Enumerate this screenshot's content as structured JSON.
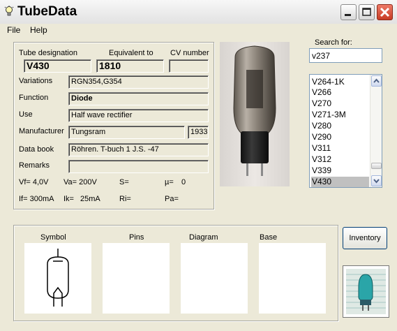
{
  "window": {
    "title": "TubeData",
    "app_icon": "lightbulb-icon"
  },
  "menu": {
    "file": "File",
    "help": "Help"
  },
  "fields": {
    "tube_designation_label": "Tube designation",
    "tube_designation": "V430",
    "equivalent_label": "Equivalent to",
    "equivalent": "1810",
    "cv_label": "CV number",
    "cv": "",
    "variations_label": "Variations",
    "variations": "RGN354,G354",
    "function_label": "Function",
    "function": "Diode",
    "use_label": "Use",
    "use": "Half wave rectifier",
    "manufacturer_label": "Manufacturer",
    "manufacturer": "Tungsram",
    "year": "1933",
    "databook_label": "Data book",
    "databook": "Röhren. T-buch 1 J.S. -47",
    "remarks_label": "Remarks",
    "remarks": ""
  },
  "params": {
    "vf": "Vf= 4,0V",
    "va": "Va= 200V",
    "s": "S=",
    "mu": "µ=",
    "mu_value": "0",
    "if": "If= 300mA",
    "ik": "Ik=",
    "ik_value": "25mA",
    "ri": "Ri=",
    "pa": "Pa="
  },
  "search": {
    "label": "Search for:",
    "value": "v237"
  },
  "list": {
    "items": [
      "V264-1K",
      "V266",
      "V270",
      "V271-3M",
      "V280",
      "V290",
      "V311",
      "V312",
      "V339",
      "V430"
    ],
    "selected": "V430"
  },
  "bottom": {
    "symbol": "Symbol",
    "pins": "Pins",
    "diagram": "Diagram",
    "base": "Base"
  },
  "buttons": {
    "inventory": "Inventory"
  },
  "colors": {
    "selection": "#c0c0c0",
    "face": "#ECE9D8",
    "close": "#d9442b"
  }
}
